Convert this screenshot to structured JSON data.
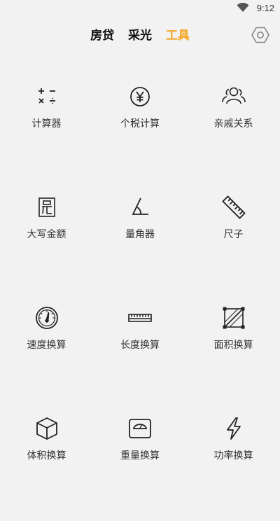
{
  "colors": {
    "accent": "#f5a623",
    "text": "#222222",
    "background": "#f2f2f2"
  },
  "status_bar": {
    "time": "9:12",
    "wifi_icon": "wifi-icon"
  },
  "header": {
    "tabs": [
      {
        "label": "房贷",
        "active": false
      },
      {
        "label": "采光",
        "active": false
      },
      {
        "label": "工具",
        "active": true
      }
    ],
    "settings_icon": "hexagon-settings-icon"
  },
  "tools": [
    {
      "label": "计算器",
      "icon": "calculator-icon"
    },
    {
      "label": "个税计算",
      "icon": "yuan-coin-icon"
    },
    {
      "label": "亲戚关系",
      "icon": "people-icon"
    },
    {
      "label": "大写金额",
      "icon": "yuan-character-icon"
    },
    {
      "label": "量角器",
      "icon": "protractor-icon"
    },
    {
      "label": "尺子",
      "icon": "ruler-icon"
    },
    {
      "label": "速度换算",
      "icon": "speedometer-icon"
    },
    {
      "label": "长度换算",
      "icon": "tape-measure-icon"
    },
    {
      "label": "面积换算",
      "icon": "area-icon"
    },
    {
      "label": "体积换算",
      "icon": "cube-icon"
    },
    {
      "label": "重量换算",
      "icon": "scale-icon"
    },
    {
      "label": "功率换算",
      "icon": "lightning-icon"
    }
  ]
}
